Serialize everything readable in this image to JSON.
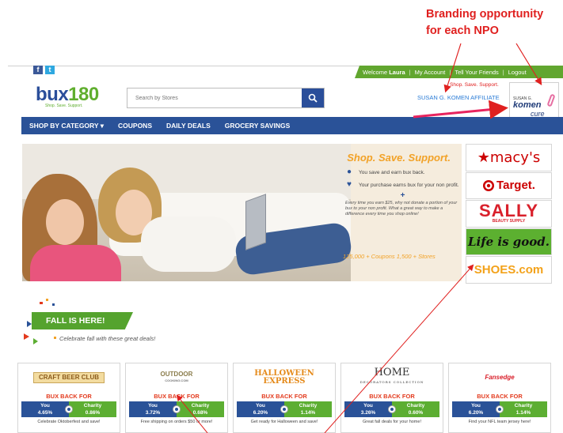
{
  "annotation": {
    "line1": "Branding opportunity",
    "line2": "for each NPO"
  },
  "social": {
    "facebook": "f",
    "twitter": "t"
  },
  "topbar": {
    "welcome_prefix": "Welcome",
    "user_name": "Laura",
    "links": [
      "My Account",
      "Tell Your Friends",
      "Logout"
    ],
    "separator": "|"
  },
  "logo": {
    "main_a": "bux",
    "main_b": "180",
    "tagline": "Shop. Save. Support."
  },
  "search": {
    "placeholder": "Search by Stores"
  },
  "npo": {
    "tagline": "Shop. Save. Support.",
    "affiliate": "SUSAN G. KOMEN AFFILIATE",
    "logo_line1": "SUSAN G.",
    "logo_line2": "komen",
    "logo_line3": "cure"
  },
  "nav": {
    "items": [
      "SHOP BY CATEGORY ▾",
      "COUPONS",
      "DAILY DEALS",
      "GROCERY SAVINGS"
    ]
  },
  "hero": {
    "title": "Shop. Save. Support.",
    "line1": "You save and earn bux back.",
    "line2": "Your purchase earns bux for your non profit.",
    "plus": "+",
    "note": "Every time you earn $25, why not donate a portion of your bux to your non profit. What a great way to make a difference every time you shop online!",
    "stats": "125,000 + Coupons   1,500 + Stores"
  },
  "brands": {
    "macys": "★macy's",
    "target": "Target.",
    "sally": "SALLY",
    "sally_sub": "BEAUTY SUPPLY",
    "lifeisgood": "Life is good.",
    "shoes": "SHOES.com"
  },
  "fall": {
    "banner": "FALL IS HERE!",
    "subtitle": "Celebrate fall with these great deals!"
  },
  "cards": [
    {
      "logo": "CRAFT BEER CLUB",
      "bux": "BUX BACK FOR",
      "you_label": "You",
      "you": "4.65%",
      "charity_label": "Charity",
      "charity": "0.86%",
      "desc": "Celebrate Oktoberfest and save!"
    },
    {
      "logo": "OUTDOOR",
      "logo_sub": "COOKING.COM",
      "bux": "BUX BACK FOR",
      "you_label": "You",
      "you": "3.72%",
      "charity_label": "Charity",
      "charity": "0.68%",
      "desc": "Free shipping on orders $50 or more!"
    },
    {
      "logo": "HALLOWEEN EXPRESS",
      "bux": "BUX BACK FOR",
      "you_label": "You",
      "you": "6.20%",
      "charity_label": "Charity",
      "charity": "1.14%",
      "desc": "Get ready for Halloween and save!"
    },
    {
      "logo": "HOME",
      "logo_sub": "DECORATORS COLLECTION",
      "bux": "BUX BACK FOR",
      "you_label": "You",
      "you": "3.26%",
      "charity_label": "Charity",
      "charity": "0.60%",
      "desc": "Great fall deals for your home!"
    },
    {
      "logo": "Fansedge",
      "bux": "BUX BACK FOR",
      "you_label": "You",
      "you": "6.20%",
      "charity_label": "Charity",
      "charity": "1.14%",
      "desc": "Find your NFL team jersey here!"
    }
  ]
}
